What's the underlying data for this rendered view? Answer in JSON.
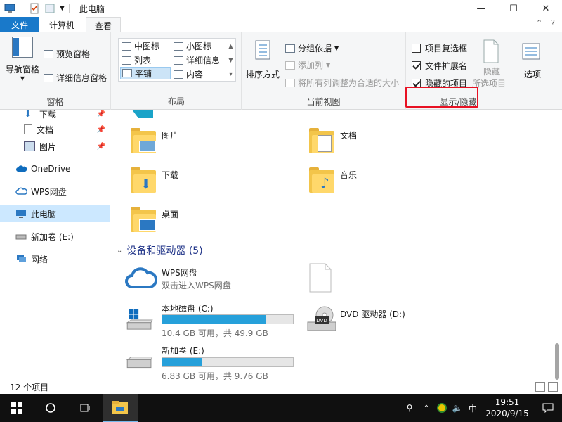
{
  "window": {
    "title": "此电脑",
    "buttons": {
      "minimize": "—",
      "maximize": "☐",
      "close": "✕"
    }
  },
  "tabs": {
    "file": "文件",
    "computer": "计算机",
    "view": "查看",
    "collapse": "⌃",
    "help": "?"
  },
  "ribbon": {
    "panes": {
      "nav_pane": "导航窗格",
      "preview_pane": "预览窗格",
      "details_pane": "详细信息窗格",
      "label": "窗格"
    },
    "layout": {
      "medium_icons": "中图标",
      "small_icons": "小图标",
      "list": "列表",
      "details": "详细信息",
      "tiles": "平铺",
      "content": "内容",
      "label": "布局"
    },
    "current_view": {
      "sort_by": "排序方式",
      "group_by": "分组依据",
      "add_columns": "添加列",
      "size_all_columns": "将所有列调整为合适的大小",
      "label": "当前视图"
    },
    "show_hide": {
      "item_checkboxes": "项目复选框",
      "file_extensions": "文件扩展名",
      "hidden_items": "隐藏的项目",
      "hide": "隐藏",
      "selected_items": "所选项目",
      "label": "显示/隐藏",
      "item_checkboxes_checked": false,
      "file_extensions_checked": true,
      "hidden_items_checked": true
    },
    "options": "选项"
  },
  "nav": {
    "items": [
      {
        "label": "下载"
      },
      {
        "label": "文档"
      },
      {
        "label": "图片"
      },
      {
        "label": "OneDrive"
      },
      {
        "label": "WPS网盘"
      },
      {
        "label": "此电脑"
      },
      {
        "label": "新加卷 (E:)"
      },
      {
        "label": "网络"
      }
    ]
  },
  "folders": [
    {
      "label": "图片"
    },
    {
      "label": "文档"
    },
    {
      "label": "下载"
    },
    {
      "label": "音乐"
    },
    {
      "label": "桌面"
    }
  ],
  "devices": {
    "heading": "设备和驱动器 (5)",
    "wps": {
      "name": "WPS网盘",
      "sub": "双击进入WPS网盘"
    },
    "c_drive": {
      "name": "本地磁盘 (C:)",
      "sub": "10.4 GB 可用，共 49.9 GB",
      "used_fraction": 0.79
    },
    "dvd": {
      "name": "DVD 驱动器 (D:)",
      "badge": "DVD"
    },
    "e_drive": {
      "name": "新加卷 (E:)",
      "sub": "6.83 GB 可用，共 9.76 GB",
      "used_fraction": 0.3
    }
  },
  "status": {
    "count": "12 个项目"
  },
  "taskbar": {
    "ime": "中",
    "time": "19:51",
    "date": "2020/9/15"
  },
  "colors": {
    "accent": "#1979ca",
    "highlight": "#e81123",
    "drive_fill": "#26a0da"
  }
}
